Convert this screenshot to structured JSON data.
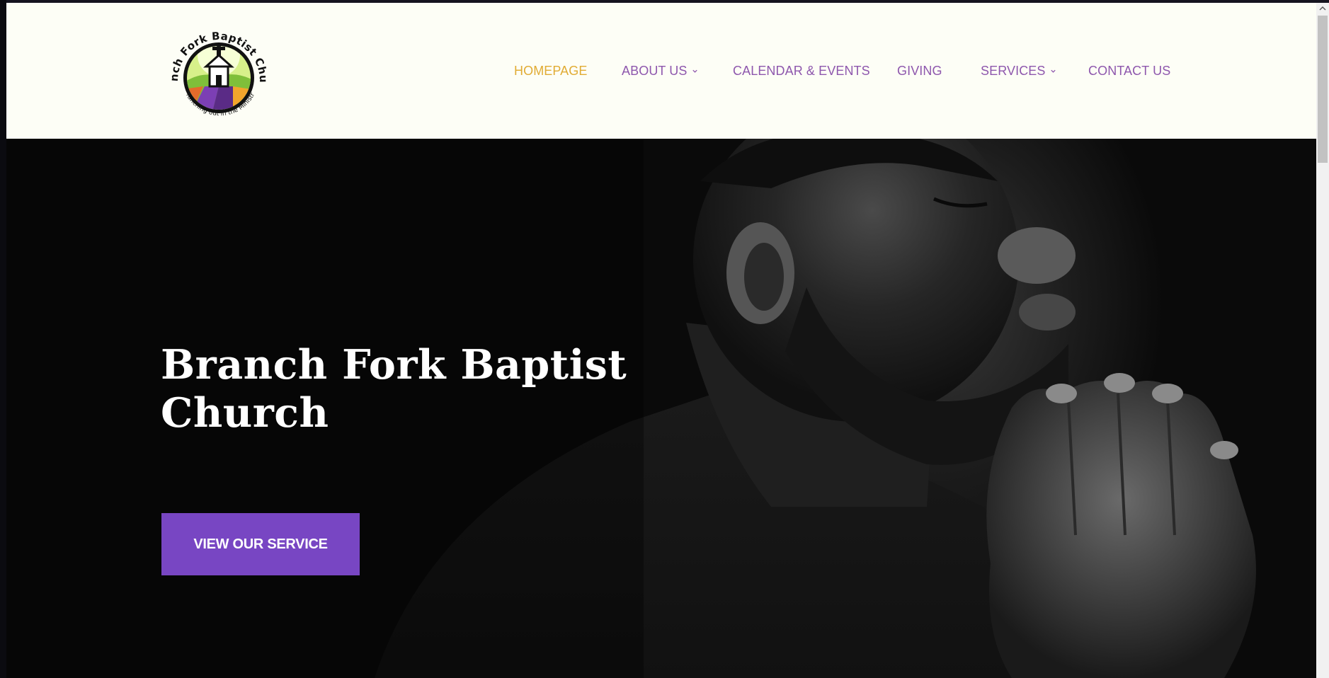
{
  "logo": {
    "top_text": "Branch Fork Baptist Church",
    "tagline": "Branching out in the Ministry"
  },
  "nav": {
    "items": [
      {
        "label": "HOMEPAGE",
        "active": true,
        "has_dropdown": false
      },
      {
        "label": "ABOUT US",
        "active": false,
        "has_dropdown": true
      },
      {
        "label": "CALENDAR & EVENTS",
        "active": false,
        "has_dropdown": false
      },
      {
        "label": "GIVING",
        "active": false,
        "has_dropdown": false
      },
      {
        "label": "SERVICES",
        "active": false,
        "has_dropdown": true
      },
      {
        "label": "CONTACT US",
        "active": false,
        "has_dropdown": false
      }
    ]
  },
  "hero": {
    "title": "Branch Fork Baptist Church",
    "button_label": "VIEW OUR SERVICE"
  },
  "colors": {
    "header_bg": "#fdfef6",
    "nav_text": "#8e57ad",
    "nav_active": "#e1ac34",
    "button_bg": "#7846c3",
    "hero_bg": "#0a0a0a"
  },
  "icons": [
    "church-logo-icon",
    "chevron-down-icon",
    "scroll-up-arrow-icon"
  ]
}
